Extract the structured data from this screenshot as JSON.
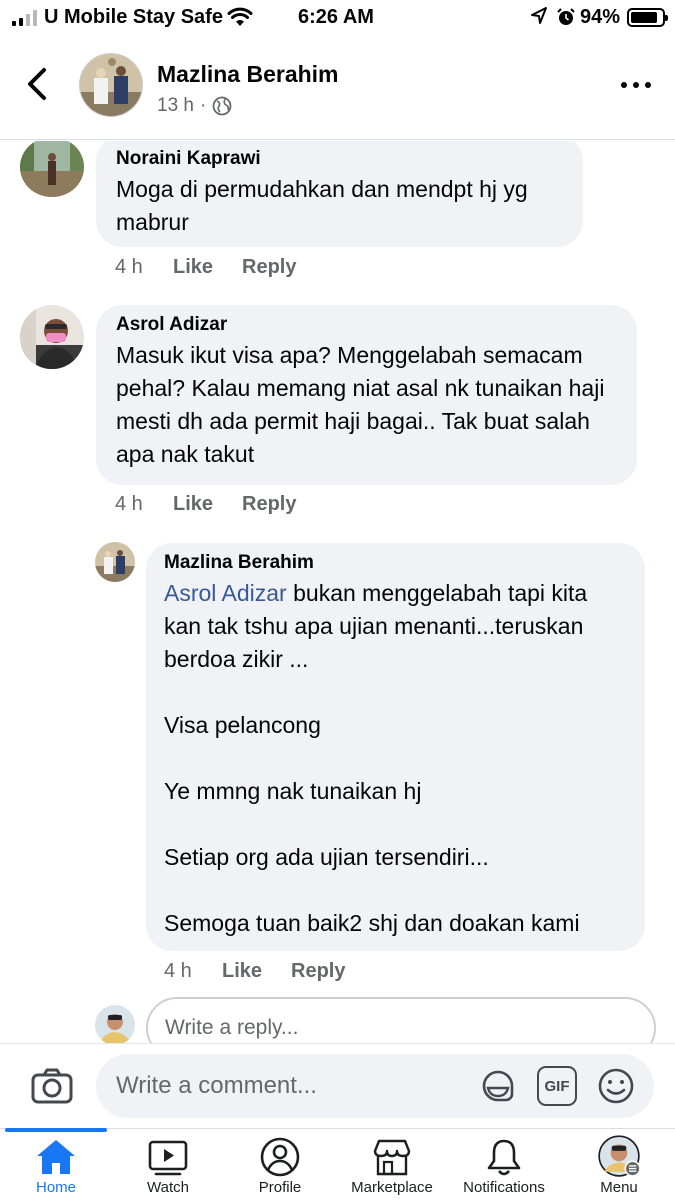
{
  "status_bar": {
    "carrier": "U Mobile Stay Safe",
    "time": "6:26 AM",
    "battery": "94%"
  },
  "header": {
    "name": "Mazlina Berahim",
    "time": "13 h",
    "separator": "·"
  },
  "comments": [
    {
      "name": "Noraini Kaprawi",
      "text": "Moga di permudahkan dan mendpt hj yg mabrur",
      "time": "4 h",
      "like": "Like",
      "reply": "Reply"
    },
    {
      "name": "Asrol Adizar",
      "text": "Masuk ikut visa apa? Menggelabah semacam pehal? Kalau memang niat asal nk tunaikan haji mesti dh ada permit haji bagai.. Tak buat salah apa nak takut",
      "time": "4 h",
      "like": "Like",
      "reply": "Reply"
    }
  ],
  "reply": {
    "name": "Mazlina Berahim",
    "mention": "Asrol Adizar",
    "text_first": " bukan menggelabah tapi kita kan tak tshu apa ujian menanti...teruskan berdoa zikir ...",
    "paragraphs": [
      "Visa pelancong",
      "Ye mmng nak tunaikan hj",
      "Setiap org ada ujian tersendiri...",
      "Semoga tuan baik2 shj dan doakan kami"
    ],
    "time": "4 h",
    "like": "Like",
    "reply": "Reply"
  },
  "reply_box": {
    "placeholder": "Write a reply..."
  },
  "composer": {
    "placeholder": "Write a comment...",
    "gif_label": "GIF"
  },
  "nav": [
    {
      "label": "Home",
      "icon": "home-icon",
      "active": true
    },
    {
      "label": "Watch",
      "icon": "watch-icon"
    },
    {
      "label": "Profile",
      "icon": "profile-icon"
    },
    {
      "label": "Marketplace",
      "icon": "marketplace-icon"
    },
    {
      "label": "Notifications",
      "icon": "bell-icon"
    },
    {
      "label": "Menu",
      "icon": "menu-avatar"
    }
  ],
  "colors": {
    "accent": "#1877f2",
    "bubble": "#f0f2f5",
    "mention": "#385898",
    "secondary_text": "#65676b"
  }
}
